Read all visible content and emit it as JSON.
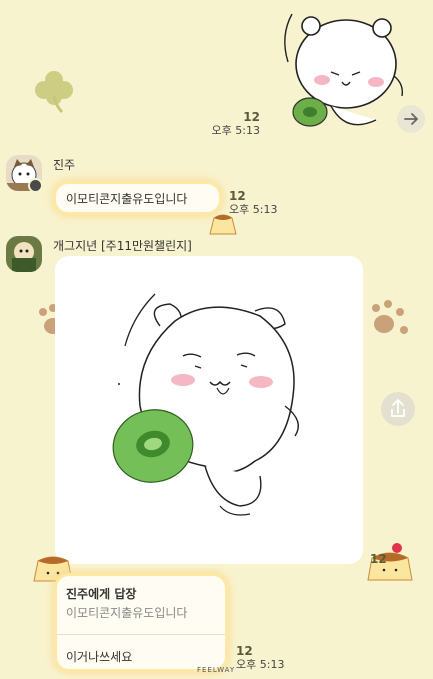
{
  "colors": {
    "background": "#f8f3cf",
    "bubble": "#fffdf3",
    "bubble_glow": "#fde8a6",
    "green": "#74bf57"
  },
  "top_message": {
    "read_count": "12",
    "time": "오후 5:13",
    "icons": [
      "clover-sticker-icon",
      "bear-sticker-icon",
      "forward-icon"
    ]
  },
  "msg1": {
    "sender": "진주",
    "text": "이모티콘지출유도입니다",
    "read_count": "12",
    "time": "오후 5:13"
  },
  "msg2": {
    "sender": "개그지년 [주11만원챌린지]",
    "image": "bear-drawing-image",
    "read_count": "12",
    "share_icon": "share-icon"
  },
  "reply": {
    "header": "진주에게 답장",
    "quoted": "이모티콘지출유도입니다",
    "text": "이거나쓰세요",
    "read_count": "12",
    "time": "오후 5:13"
  },
  "watermark": "FEELWAY"
}
